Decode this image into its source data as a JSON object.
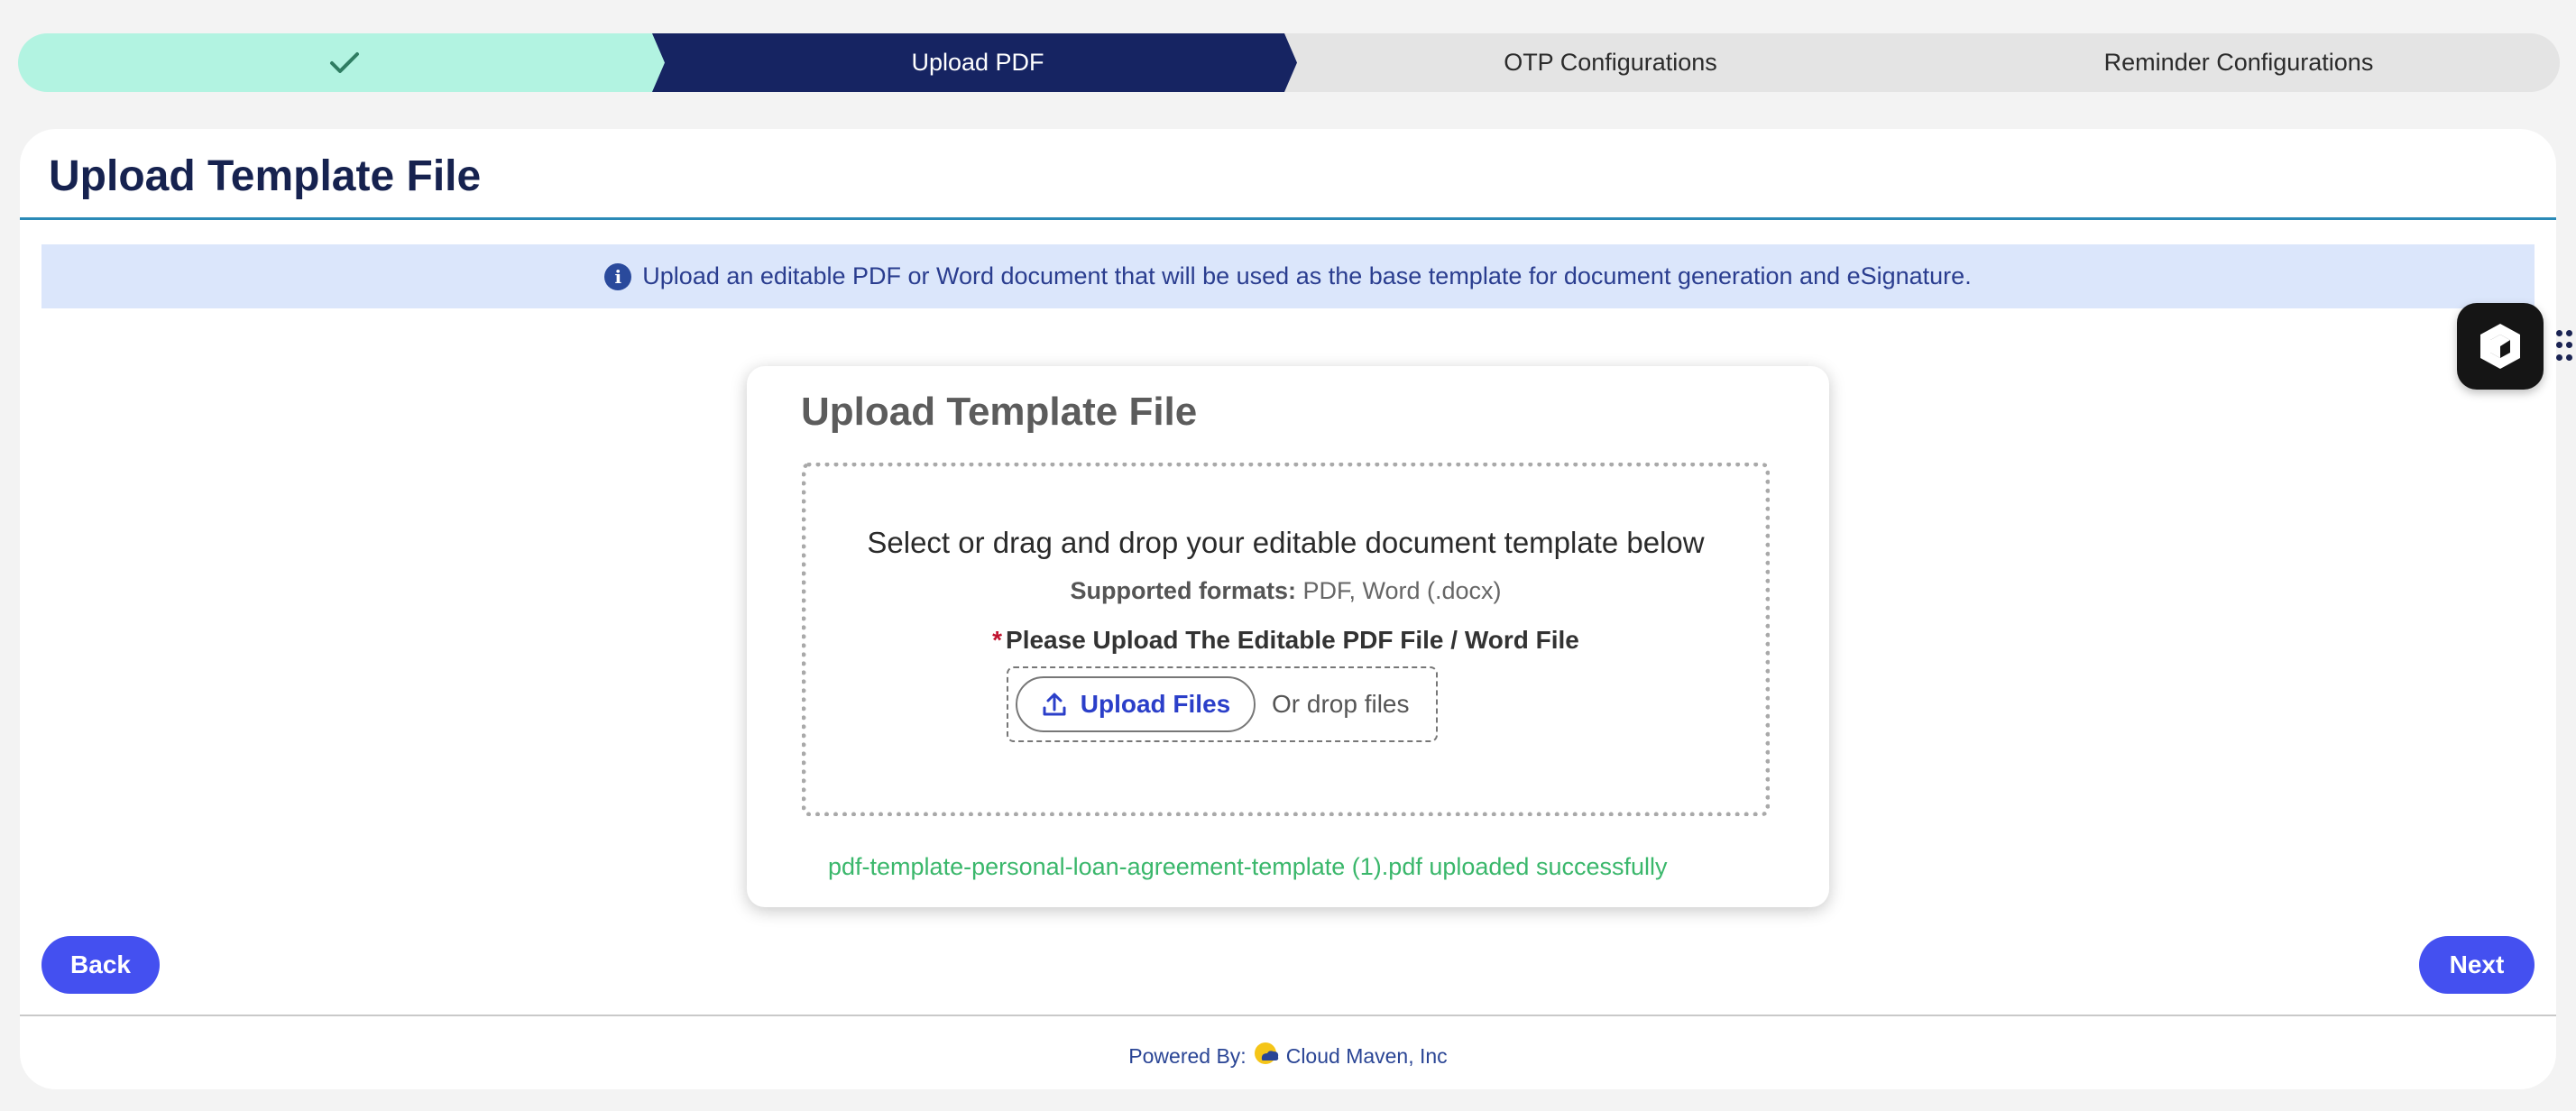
{
  "stepper": {
    "steps": [
      {
        "label": "",
        "status": "completed",
        "icon": "check-icon"
      },
      {
        "label": "Upload PDF",
        "status": "active"
      },
      {
        "label": "OTP Configurations",
        "status": "pending"
      },
      {
        "label": "Reminder Configurations",
        "status": "pending"
      }
    ]
  },
  "page": {
    "title": "Upload Template File",
    "info_banner": "Upload an editable PDF or Word document that will be used as the base template for document generation and eSignature."
  },
  "upload_card": {
    "title": "Upload Template File",
    "instructions": "Select or drag and drop your editable document template below",
    "formats_label": "Supported formats:",
    "formats_value": "PDF, Word (.docx)",
    "field_label": "Please Upload The Editable PDF File / Word File",
    "required_marker": "*",
    "upload_button_label": "Upload Files",
    "drop_text": "Or drop files",
    "success_message": "pdf-template-personal-loan-agreement-template (1).pdf uploaded successfully"
  },
  "nav": {
    "back_label": "Back",
    "next_label": "Next"
  },
  "footer": {
    "powered_by": "Powered By:",
    "company": "Cloud Maven, Inc"
  },
  "colors": {
    "completed_step": "#b2f3e1",
    "active_step": "#162462",
    "pending_step": "#e4e4e4",
    "primary_button": "#4450f0",
    "success_text": "#3ab76b",
    "info_banner_bg": "#dbe6fb"
  }
}
